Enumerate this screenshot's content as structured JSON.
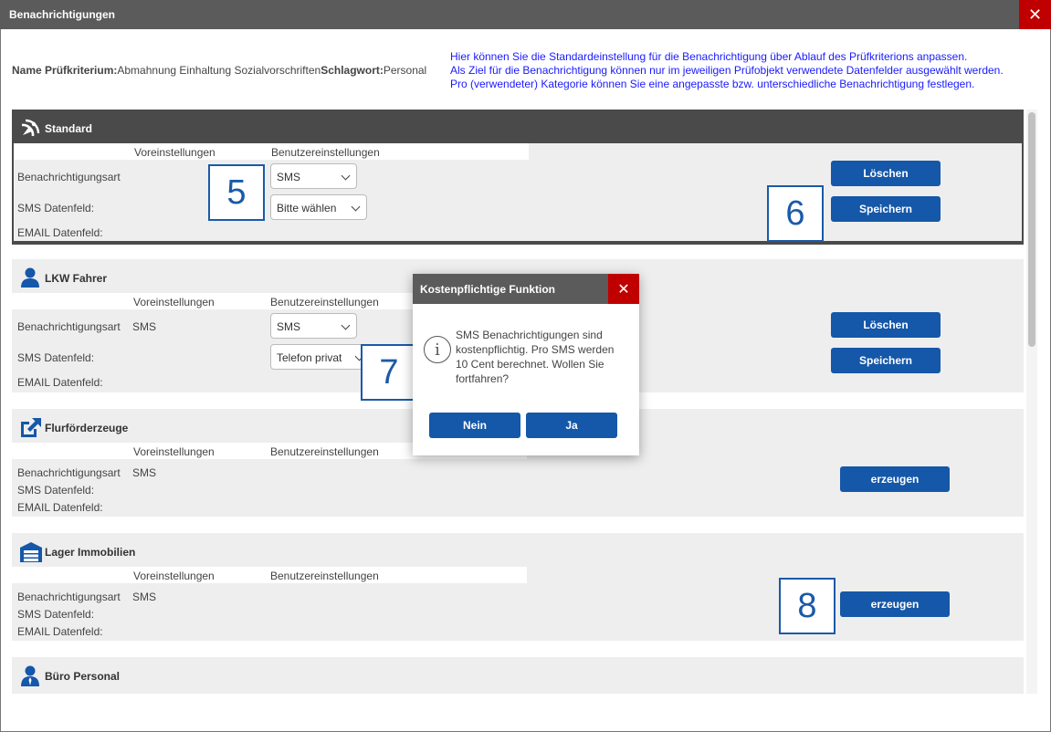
{
  "window": {
    "title": "Benachrichtigungen",
    "close_symbol": "✕"
  },
  "info": {
    "name_label": "Name Prüfkriterium:",
    "name_value": "Abmahnung Einhaltung Sozialvorschriften",
    "keyword_label": "Schlagwort:",
    "keyword_value": "Personal"
  },
  "hint_lines": [
    "Hier können Sie die Standardeinstellung für die Benachrichtigung über Ablauf des Prüfkriterions anpassen.",
    "Als Ziel für die Benachrichtigung können nur im jeweiligen Prüfobjekt verwendete Datenfelder ausgewählt werden.",
    "Pro (verwendeter) Kategorie können Sie eine angepasste bzw. unterschiedliche Benachrichtigung festlegen."
  ],
  "columns": {
    "defaults": "Voreinstellungen",
    "user": "Benutzereinstellungen"
  },
  "rows": {
    "type": "Benachrichtigungsart",
    "sms_field": "SMS Datenfeld:",
    "email_field": "EMAIL Datenfeld:"
  },
  "sections": [
    {
      "title": "Standard",
      "icon": "satellite-dish-icon",
      "default_type": "",
      "select_type": "SMS",
      "select_sms": "Bitte wählen",
      "btn_delete": "Löschen",
      "btn_save": "Speichern"
    },
    {
      "title": "LKW Fahrer",
      "icon": "user-icon",
      "default_type": "SMS",
      "select_type": "SMS",
      "select_sms": "Telefon privat",
      "btn_delete": "Löschen",
      "btn_save": "Speichern"
    },
    {
      "title": "Flurförderzeuge",
      "icon": "external-link-icon",
      "default_type": "SMS",
      "btn_create": "erzeugen"
    },
    {
      "title": "Lager Immobilien",
      "icon": "warehouse-icon",
      "default_type": "SMS",
      "btn_create": "erzeugen"
    },
    {
      "title": "Büro Personal",
      "icon": "business-user-icon"
    }
  ],
  "markers": [
    "5",
    "6",
    "7",
    "8"
  ],
  "dialog": {
    "title": "Kostenpflichtige Funktion",
    "close_symbol": "✕",
    "info_symbol": "i",
    "message": "SMS Benachrichtigungen sind kostenpflichtig. Pro SMS werden 10 Cent berechnet. Wollen Sie fortfahren?",
    "btn_no": "Nein",
    "btn_yes": "Ja"
  },
  "colors": {
    "accent": "#1557a8",
    "close_red": "#c00000",
    "header_gray": "#5b5b5b",
    "hint_blue": "#1a1aff"
  }
}
